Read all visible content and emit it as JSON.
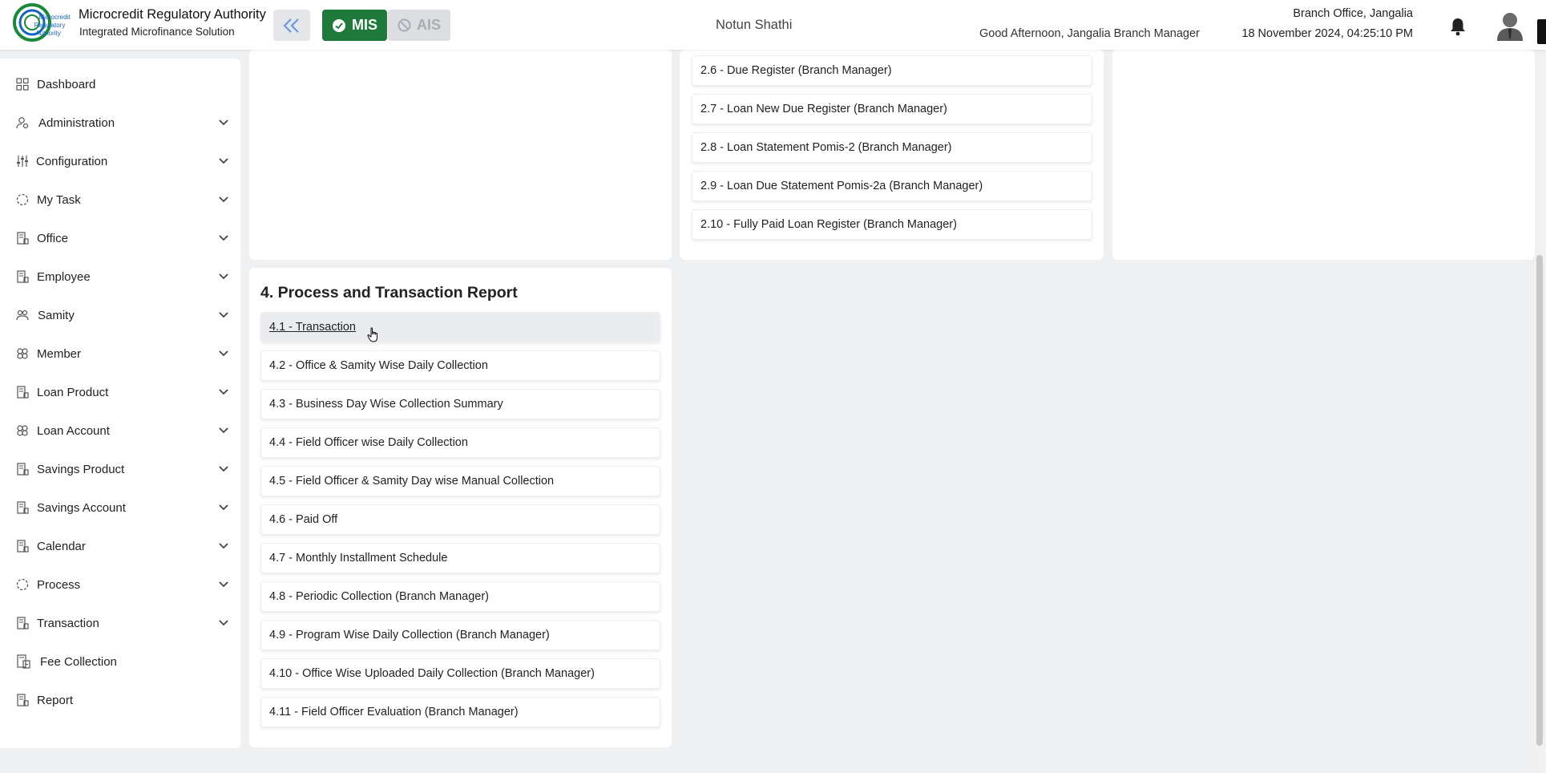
{
  "header": {
    "brand_title": "Microcredit Regulatory Authority",
    "brand_subtitle": "Integrated Microfinance Solution",
    "logo_text": "Microcredit Regulatory Authority",
    "mis_label": "MIS",
    "ais_label": "AIS",
    "center_title": "Notun Shathi",
    "greeting": "Good Afternoon, Jangalia Branch Manager",
    "office_name": "Branch Office, Jangalia",
    "datetime": "18 November 2024, 04:25:10 PM"
  },
  "colors": {
    "mis_green": "#1e7a3a",
    "ais_disabled": "#dcdee1",
    "collapse_icon": "#6a9be0"
  },
  "sidebar": {
    "items": [
      {
        "label": "Dashboard",
        "icon": "grid-icon",
        "expandable": false
      },
      {
        "label": "Administration",
        "icon": "user-gear-icon",
        "expandable": true
      },
      {
        "label": "Configuration",
        "icon": "sliders-icon",
        "expandable": true
      },
      {
        "label": "My Task",
        "icon": "dotted-circle-icon",
        "expandable": true
      },
      {
        "label": "Office",
        "icon": "building-icon",
        "expandable": true
      },
      {
        "label": "Employee",
        "icon": "building-icon",
        "expandable": true
      },
      {
        "label": "Samity",
        "icon": "group-icon",
        "expandable": true
      },
      {
        "label": "Member",
        "icon": "people-icon",
        "expandable": true
      },
      {
        "label": "Loan Product",
        "icon": "building-icon",
        "expandable": true
      },
      {
        "label": "Loan Account",
        "icon": "people-icon",
        "expandable": true
      },
      {
        "label": "Savings Product",
        "icon": "building-icon",
        "expandable": true
      },
      {
        "label": "Savings Account",
        "icon": "building-icon",
        "expandable": true
      },
      {
        "label": "Calendar",
        "icon": "building-icon",
        "expandable": true
      },
      {
        "label": "Process",
        "icon": "dotted-circle-icon",
        "expandable": true
      },
      {
        "label": "Transaction",
        "icon": "building-icon",
        "expandable": true
      },
      {
        "label": "Fee Collection",
        "icon": "fee-icon",
        "expandable": false
      },
      {
        "label": "Report",
        "icon": "building-icon",
        "expandable": false
      }
    ]
  },
  "loan_reports": [
    "2.6 - Due Register (Branch Manager)",
    "2.7 - Loan New Due Register (Branch Manager)",
    "2.8 - Loan Statement Pomis-2 (Branch Manager)",
    "2.9 - Loan Due Statement Pomis-2a (Branch Manager)",
    "2.10 - Fully Paid Loan Register (Branch Manager)"
  ],
  "process_section": {
    "title": "4. Process and Transaction Report",
    "items": [
      "4.1 - Transaction",
      "4.2 - Office & Samity Wise Daily Collection",
      "4.3 - Business Day Wise Collection Summary",
      "4.4 - Field Officer wise Daily Collection",
      "4.5 - Field Officer & Samity Day wise Manual Collection",
      "4.6 - Paid Off",
      "4.7 - Monthly Installment Schedule",
      "4.8 - Periodic Collection (Branch Manager)",
      "4.9 - Program Wise Daily Collection (Branch Manager)",
      "4.10 - Office Wise Uploaded Daily Collection (Branch Manager)",
      "4.11 - Field Officer Evaluation (Branch Manager)"
    ]
  }
}
